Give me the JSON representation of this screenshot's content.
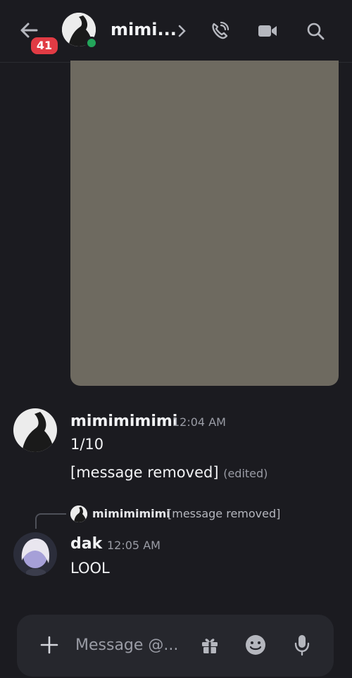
{
  "header": {
    "unread_count": "41",
    "channel_name": "mimi...",
    "icons": [
      "back-arrow-icon",
      "chevron-right-icon",
      "phone-call-icon",
      "video-camera-icon",
      "search-icon"
    ]
  },
  "messages": [
    {
      "author": "mimimimimi",
      "time": "12:04 AM",
      "lines": [
        "1/10",
        "[message removed]"
      ],
      "edited_label": "(edited)"
    },
    {
      "reply_to": {
        "author": "mimimimimi",
        "text": "[message removed]"
      },
      "author": "dak",
      "time": "12:05 AM",
      "lines": [
        "LOOL"
      ]
    }
  ],
  "composer": {
    "placeholder": "Message @...",
    "icons": [
      "plus-icon",
      "gift-icon",
      "emoji-icon",
      "microphone-icon"
    ]
  },
  "colors": {
    "background": "#1b1b20",
    "badge": "#e13b44",
    "online": "#23a55a",
    "composer": "#26272d"
  }
}
